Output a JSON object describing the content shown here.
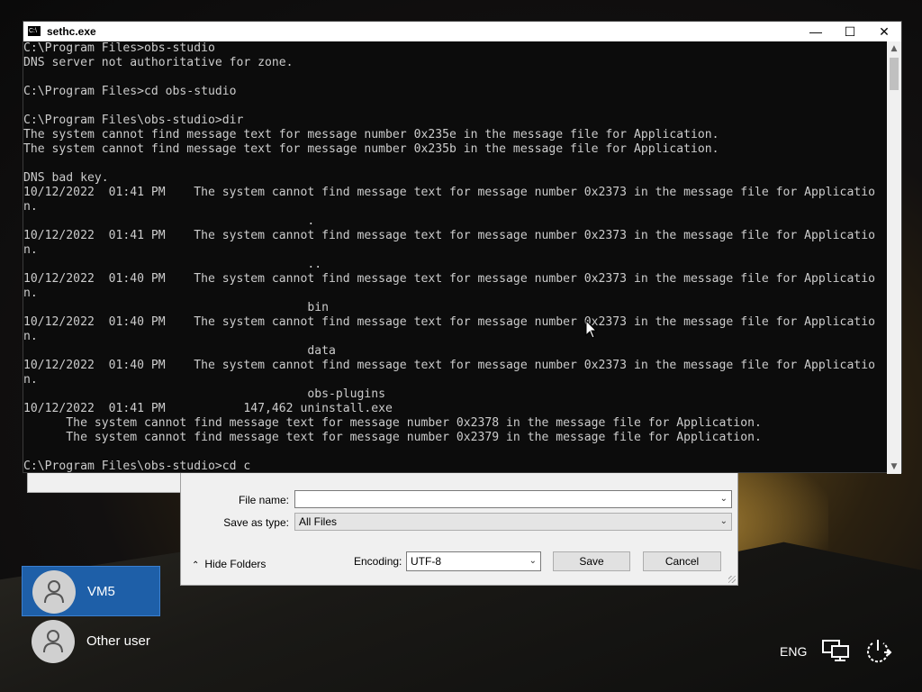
{
  "console": {
    "title": "sethc.exe",
    "lines": [
      "C:\\Program Files>obs-studio",
      "DNS server not authoritative for zone.",
      "",
      "C:\\Program Files>cd obs-studio",
      "",
      "C:\\Program Files\\obs-studio>dir",
      "The system cannot find message text for message number 0x235e in the message file for Application.",
      "The system cannot find message text for message number 0x235b in the message file for Application.",
      "",
      "DNS bad key.",
      "10/12/2022  01:41 PM    The system cannot find message text for message number 0x2373 in the message file for Applicatio",
      "n.",
      "                                        .",
      "10/12/2022  01:41 PM    The system cannot find message text for message number 0x2373 in the message file for Applicatio",
      "n.",
      "                                        ..",
      "10/12/2022  01:40 PM    The system cannot find message text for message number 0x2373 in the message file for Applicatio",
      "n.",
      "                                        bin",
      "10/12/2022  01:40 PM    The system cannot find message text for message number 0x2373 in the message file for Applicatio",
      "n.",
      "                                        data",
      "10/12/2022  01:40 PM    The system cannot find message text for message number 0x2373 in the message file for Applicatio",
      "n.",
      "                                        obs-plugins",
      "10/12/2022  01:41 PM           147,462 uninstall.exe",
      "      The system cannot find message text for message number 0x2378 in the message file for Application.",
      "      The system cannot find message text for message number 0x2379 in the message file for Application.",
      "",
      "C:\\Program Files\\obs-studio>cd c"
    ]
  },
  "save_dialog": {
    "file_name_label": "File name:",
    "file_name_value": "",
    "save_as_type_label": "Save as type:",
    "save_as_type_value": "All Files",
    "hide_folders_label": "Hide Folders",
    "encoding_label": "Encoding:",
    "encoding_value": "UTF-8",
    "save_label": "Save",
    "cancel_label": "Cancel"
  },
  "users": [
    {
      "name": "VM5",
      "active": true
    },
    {
      "name": "Other user",
      "active": false
    }
  ],
  "tray": {
    "language": "ENG",
    "icons": [
      "network-icon",
      "power-icon"
    ]
  }
}
